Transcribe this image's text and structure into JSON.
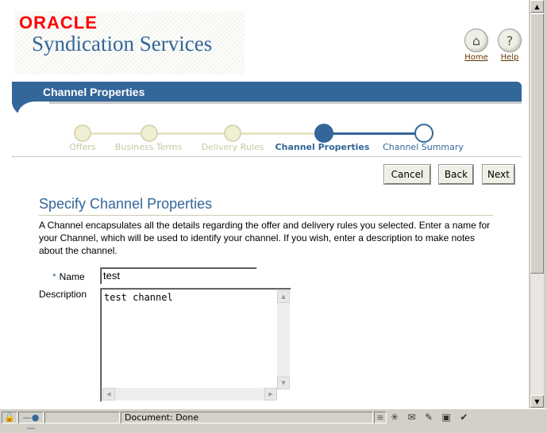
{
  "header": {
    "vendor_logo": "ORACLE",
    "product_name": "Syndication Services",
    "global_buttons": [
      {
        "label": "Home",
        "icon": "home-icon"
      },
      {
        "label": "Help",
        "icon": "help-icon"
      }
    ]
  },
  "page_header": {
    "title": "Channel Properties"
  },
  "train": {
    "steps": [
      {
        "label": "Offers",
        "state": "visited"
      },
      {
        "label": "Business Terms",
        "state": "visited"
      },
      {
        "label": "Delivery Rules",
        "state": "visited"
      },
      {
        "label": "Channel Properties",
        "state": "current"
      },
      {
        "label": "Channel Summary",
        "state": "next"
      }
    ]
  },
  "actions": {
    "cancel": "Cancel",
    "back": "Back",
    "next": "Next"
  },
  "section": {
    "title": "Specify Channel Properties",
    "instructions": "A Channel encapsulates all the details regarding the offer and delivery rules you selected. Enter a name for your Channel, which will be used to identify your channel. If you wish, enter a description to make notes about the channel."
  },
  "form": {
    "name_required_marker": "*",
    "name_label": "Name",
    "name_value": "test",
    "description_label": "Description",
    "description_value": "test channel"
  },
  "status_bar": {
    "text": "Document: Done"
  },
  "colors": {
    "brand": "#336699",
    "oracle_red": "#ff0000",
    "visited_step": "#f0efd4"
  }
}
